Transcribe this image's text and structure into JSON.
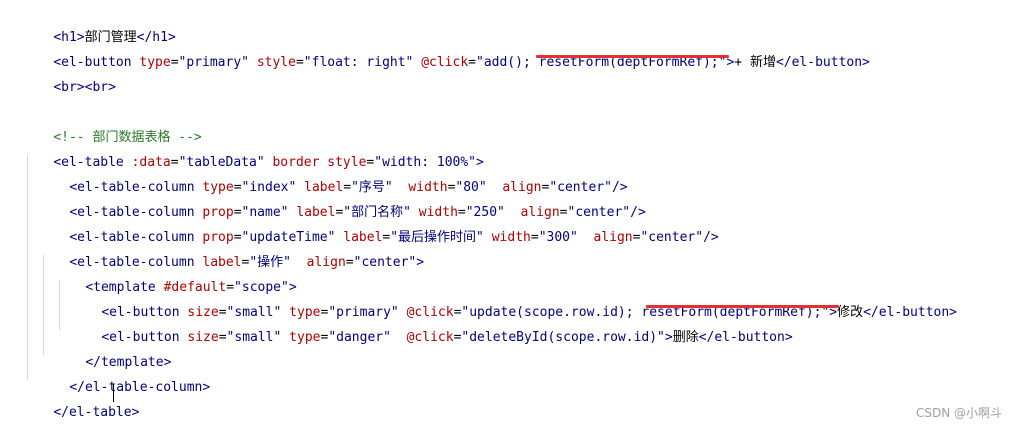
{
  "code": {
    "l1": [
      "<h1>",
      "部门管理",
      "</h1>"
    ],
    "l2": [
      "<el-button ",
      "type",
      "=",
      "\"primary\"",
      " ",
      "style",
      "=",
      "\"float: right\"",
      " ",
      "@click",
      "=",
      "\"add(); ",
      "resetForm(deptFormRef);",
      "\"",
      ">",
      "+ 新增",
      "</el-button>"
    ],
    "l3": [
      "<br><br>"
    ],
    "l5": [
      "<!-- 部门数据表格 -->"
    ],
    "l6": [
      "<el-table ",
      ":data",
      "=",
      "\"tableData\"",
      " ",
      "border",
      " ",
      "style",
      "=",
      "\"width: 100%\"",
      ">"
    ],
    "l7": [
      "<el-table-column ",
      "type",
      "=",
      "\"index\"",
      " ",
      "label",
      "=",
      "\"序号\"",
      "  ",
      "width",
      "=",
      "\"80\"",
      "  ",
      "align",
      "=",
      "\"center\"",
      "/>"
    ],
    "l8": [
      "<el-table-column ",
      "prop",
      "=",
      "\"name\"",
      " ",
      "label",
      "=",
      "\"部门名称\"",
      " ",
      "width",
      "=",
      "\"250\"",
      "  ",
      "align",
      "=",
      "\"center\"",
      "/>"
    ],
    "l9": [
      "<el-table-column ",
      "prop",
      "=",
      "\"updateTime\"",
      " ",
      "label",
      "=",
      "\"最后操作时间\"",
      " ",
      "width",
      "=",
      "\"300\"",
      "  ",
      "align",
      "=",
      "\"center\"",
      "/>"
    ],
    "l10": [
      "<el-table-column ",
      "label",
      "=",
      "\"操作\"",
      "  ",
      "align",
      "=",
      "\"center\"",
      ">"
    ],
    "l11": [
      "<template ",
      "#default",
      "=",
      "\"scope\"",
      ">"
    ],
    "l12": [
      "<el-button ",
      "size",
      "=",
      "\"small\"",
      " ",
      "type",
      "=",
      "\"primary\"",
      " ",
      "@click",
      "=",
      "\"update(scope.row.id); ",
      "resetForm(deptFormRef);",
      "\"",
      ">",
      "修改",
      "</el-button>"
    ],
    "l13": [
      "<el-button ",
      "size",
      "=",
      "\"small\"",
      " ",
      "type",
      "=",
      "\"danger\"",
      "  ",
      "@click",
      "=",
      "\"deleteById(scope.row.id)\"",
      ">",
      "删除",
      "</el-button>"
    ],
    "l14": [
      "</template>"
    ],
    "l15": [
      "</el-table-column>"
    ],
    "l16": [
      "</el-table>"
    ]
  },
  "watermark": "CSDN @小啊斗",
  "colors": {
    "tag": "#000080",
    "attribute": "#b00000",
    "comment": "#2a7a2a",
    "underline": "#e33030"
  }
}
